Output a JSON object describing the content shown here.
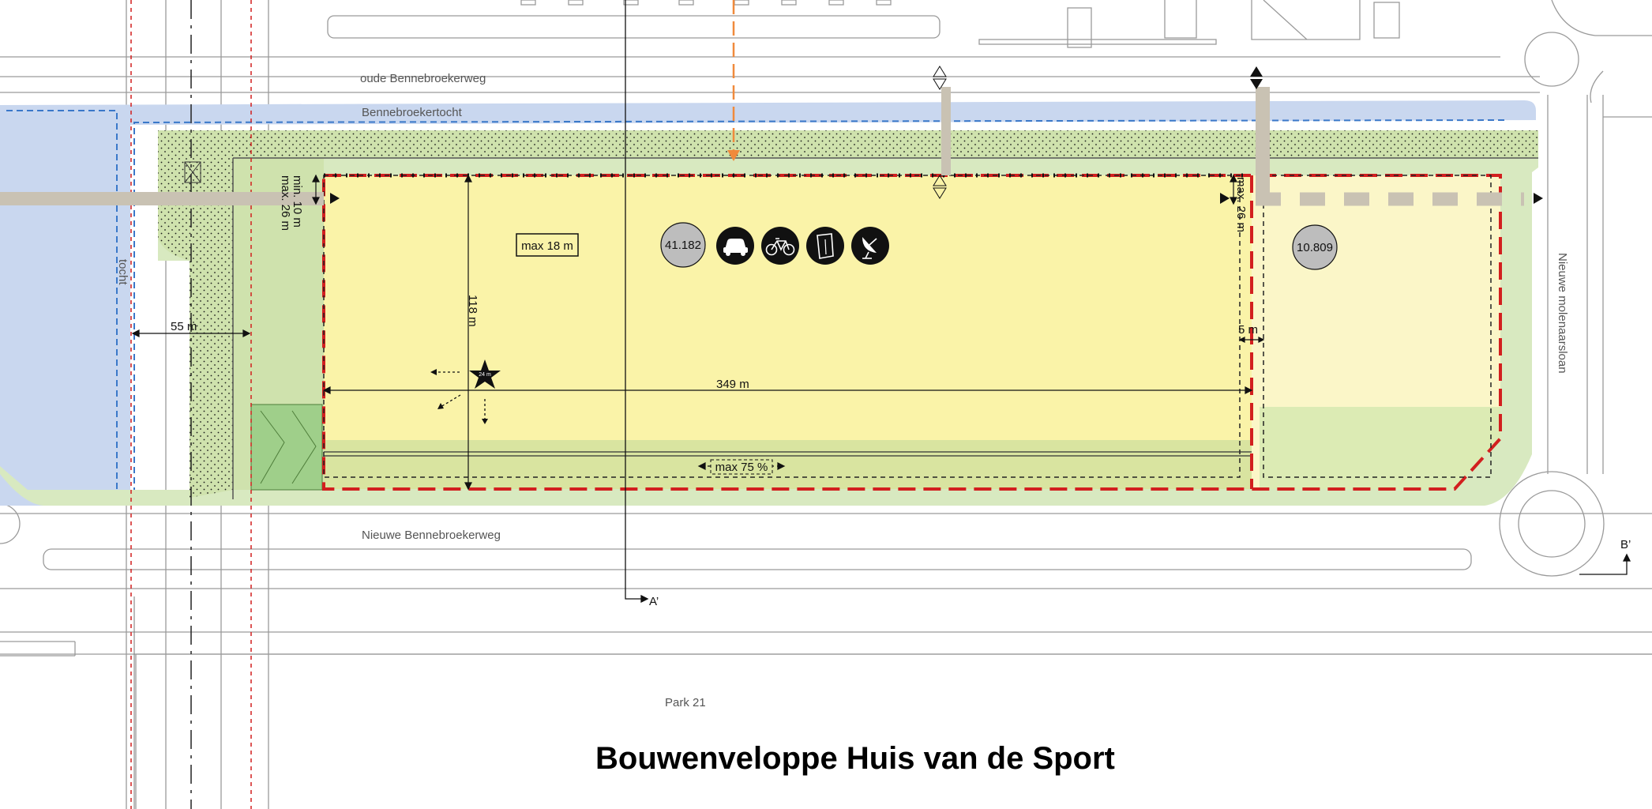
{
  "title": "Bouwenveloppe Huis van de Sport",
  "streets": {
    "oude_bennebroekerweg": "oude Bennebroekerweg",
    "bennebroekertocht": "Bennebroekertocht",
    "nieuwe_bennebroekerweg": "Nieuwe Bennebroekerweg",
    "nieuwe_molenaarsloan": "Nieuwe molenaarsloan",
    "tocht": "tocht",
    "park": "Park 21"
  },
  "dimensions": {
    "height_max": "max 18 m",
    "length": "349 m",
    "depth": "118 m",
    "setback_canal": "55 m",
    "setback_min_max": "min. 10 m max. 26 m",
    "setback_min": "min. 10 m",
    "setback_max": "max. 26 m",
    "east_max": "max. 26 m",
    "east_setback": "5 m",
    "coverage": "max 75 %"
  },
  "areas": {
    "main": "41.182",
    "secondary": "10.809"
  },
  "section_markers": {
    "a": "A’",
    "b": "B’"
  },
  "landmark_label": "24 m",
  "icons": [
    "car-icon",
    "bicycle-icon",
    "waste-bin-icon",
    "satellite-dish-icon"
  ],
  "colors": {
    "water": "#c9d7ef",
    "green": "#cfe2ad",
    "plot": "#faf3a8",
    "plot_east": "#fbf6c8",
    "boundary_red": "#d21f1f",
    "path": "#c9c2b3",
    "access_orange": "#f08a3c",
    "water_line": "#3a78c9"
  }
}
